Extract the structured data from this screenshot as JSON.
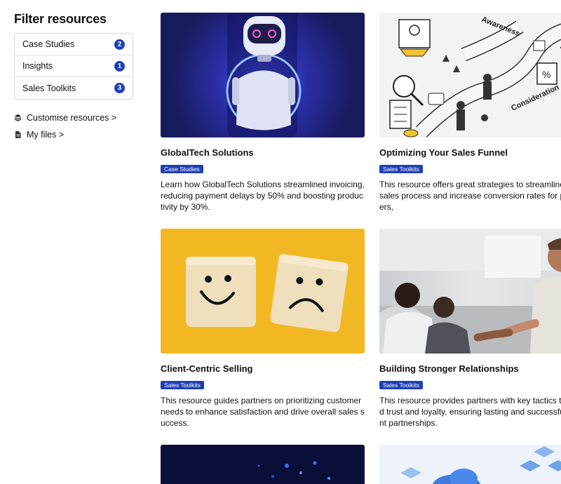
{
  "sidebar": {
    "title": "Filter resources",
    "filters": [
      {
        "label": "Case Studies",
        "count": "2"
      },
      {
        "label": "Insights",
        "count": "1"
      },
      {
        "label": "Sales Toolkits",
        "count": "3"
      }
    ],
    "links": [
      {
        "label": "Customise resources >",
        "icon": "layers-icon"
      },
      {
        "label": "My files >",
        "icon": "file-icon"
      }
    ]
  },
  "cards": [
    {
      "title": "GlobalTech Solutions",
      "tag": "Case Studies",
      "description": "Learn how GlobalTech Solutions streamlined invoicing, reducing payment delays by 50% and boosting productivity by 30%."
    },
    {
      "title": "Optimizing Your Sales Funnel",
      "tag": "Sales Toolkits",
      "description": "This resource offers great strategies to streamline your sales process and increase conversion rates for partners,"
    },
    {
      "title": "Client-Centric Selling",
      "tag": "Sales Toolkits",
      "description": "This resource guides partners on prioritizing customer needs to enhance satisfaction and drive overall sales success."
    },
    {
      "title": "Building Stronger Relationships",
      "tag": "Sales Toolkits",
      "description": "This resource provides partners with key tactics to build trust and loyalty, ensuring lasting and successful client partnerships."
    }
  ],
  "illustration_text": {
    "funnel_word_1": "Awareness",
    "funnel_word_2": "Consideration",
    "percent_sign": "%"
  },
  "colors": {
    "accent": "#1f3fb5",
    "robot_bg": "#1b1f6e",
    "smile_bg": "#f2b824"
  }
}
